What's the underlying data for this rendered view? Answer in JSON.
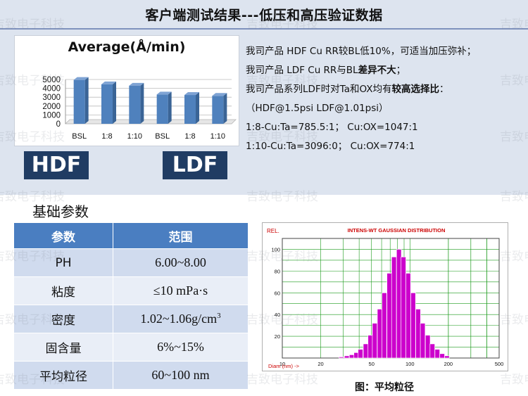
{
  "page_title": "客户端测试结果---低压和高压验证数据",
  "bar_chart": {
    "title": "Average(Å/min)",
    "badges": [
      "HDF",
      "LDF"
    ]
  },
  "notes": {
    "line1": "我司产品 HDF Cu RR较BL低10%，可适当加压弥补；",
    "line2_text": "我司产品 LDF Cu RR与BL",
    "line2_bold": "差异不大",
    "line2_tail": "；",
    "line3_text": "我司产品系列LDF时对Ta和OX均有",
    "line3_bold": "较高选择比",
    "line3_tail": "：",
    "line4": "（HDF@1.5psi    LDF@1.01psi）",
    "line5": "1:8-Cu:Ta=785.5:1；  Cu:OX=1047:1",
    "line6": "1:10-Cu:Ta=3096:0；  Cu:OX=774:1"
  },
  "params": {
    "section_title": "基础参数",
    "headers": [
      "参数",
      "范围"
    ],
    "rows": [
      {
        "name": "PH",
        "value": "6.00~8.00"
      },
      {
        "name": "粘度",
        "value": "≤10 mPa·s"
      },
      {
        "name": "密度",
        "value": "1.02~1.06g/cm",
        "sup": "3"
      },
      {
        "name": "固含量",
        "value": "6%~15%"
      },
      {
        "name": "平均粒径",
        "value": "60~100 nm"
      }
    ]
  },
  "histogram": {
    "caption": "图：平均粒径"
  },
  "watermark": "吉致电子科技",
  "colors": {
    "bar": "#4f81bd",
    "badge": "#203c63",
    "table_header": "#4a7ec1",
    "histogram_bar": "#cc00cc",
    "histogram_grid": "#1a9a1a"
  },
  "chart_data": [
    {
      "type": "bar",
      "title": "Average(Å/min)",
      "categories": [
        "BSL",
        "1:8",
        "1:10",
        "BSL",
        "1:8",
        "1:10"
      ],
      "values": [
        4950,
        4450,
        4300,
        3300,
        3250,
        3150
      ],
      "ylim": [
        0,
        5000
      ],
      "yticks": [
        0,
        1000,
        2000,
        3000,
        4000,
        5000
      ],
      "grid": true,
      "legend": "none"
    },
    {
      "type": "bar",
      "title": "INTENS-WT GAUSSIAN DISTRIBUTION",
      "ylabel": "REL.",
      "xlabel": "Diam (nm) ->",
      "xscale": "log",
      "xlim": [
        10,
        500
      ],
      "ylim": [
        0,
        110
      ],
      "yticks": [
        0,
        20,
        40,
        60,
        80,
        100
      ],
      "xticks": [
        10,
        20,
        50,
        100,
        200,
        500
      ],
      "grid": true,
      "categories": [
        29,
        32,
        35,
        38,
        41,
        45,
        49,
        53,
        58,
        63,
        69,
        75,
        82,
        89,
        97,
        106,
        116,
        126,
        138,
        150,
        164,
        179,
        195
      ],
      "values": [
        1,
        2,
        3,
        5,
        8,
        13,
        21,
        32,
        45,
        60,
        78,
        93,
        100,
        93,
        78,
        60,
        45,
        32,
        21,
        13,
        8,
        4,
        2
      ]
    }
  ]
}
